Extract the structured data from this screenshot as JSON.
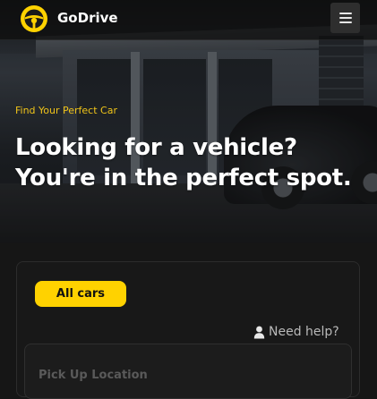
{
  "nav": {
    "brand": "GoDrive",
    "logo_icon": "steering-wheel-icon",
    "menu_icon": "hamburger-menu-icon"
  },
  "hero": {
    "eyebrow": "Find Your Perfect Car",
    "headline_line1": "Looking for a vehicle?",
    "headline_line2": "You're in the perfect spot."
  },
  "search": {
    "tab_all_cars": "All cars",
    "help_icon": "user-icon",
    "help_label": "Need help?",
    "pickup_label": "Pick Up Location"
  },
  "colors": {
    "accent": "#ffd200",
    "eyebrow": "#f0c419",
    "background": "#161616"
  }
}
